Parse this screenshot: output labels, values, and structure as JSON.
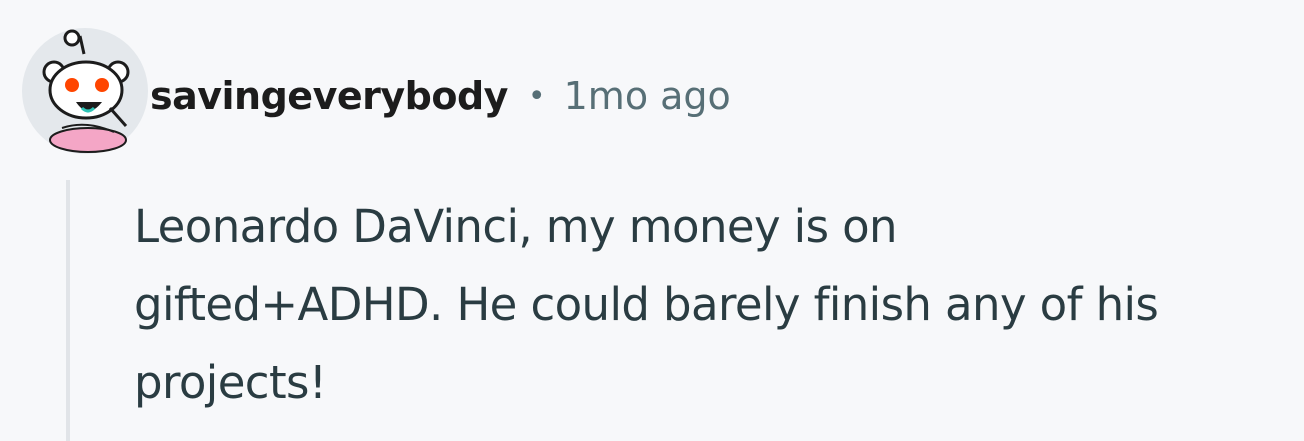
{
  "comment": {
    "author": "savingeverybody",
    "separator": "•",
    "timestamp": "1mo ago",
    "avatar_icon": "snoo-avatar-icon",
    "body_lines": [
      "Leonardo DaVinci, my money is on",
      "gifted+ADHD. He could barely finish any of his",
      "projects!"
    ]
  },
  "colors": {
    "background": "#f7f8fa",
    "username": "#1c1c1c",
    "meta": "#576f76",
    "body_text": "#2a3c42",
    "thread_line": "#e1e4e8"
  }
}
